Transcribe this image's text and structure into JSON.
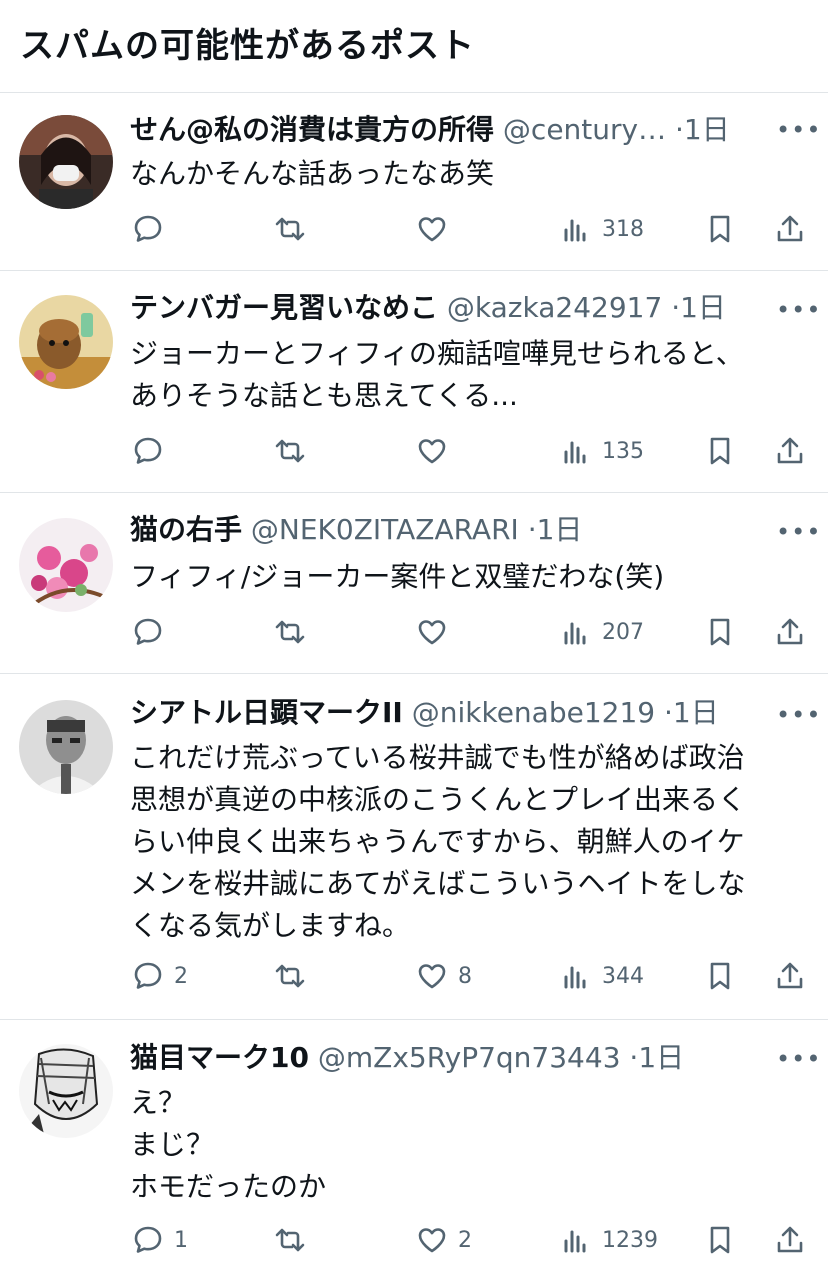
{
  "header": {
    "title": "スパムの可能性があるポスト"
  },
  "posts": [
    {
      "name": "せん@私の消費は貴方の所得",
      "handle": "@century…",
      "time": "·1日",
      "lines": [
        "なんかそんな話あったなあ笑"
      ],
      "reply_count": "",
      "like_count": "",
      "views": "318"
    },
    {
      "name": "テンバガー見習いなめこ",
      "handle": "@kazka242917",
      "time": "·1日",
      "lines": [
        "ジョーカーとフィフィの痴話喧嘩見せられると、",
        "ありそうな話とも思えてくる..."
      ],
      "reply_count": "",
      "like_count": "",
      "views": "135"
    },
    {
      "name": "猫の右手",
      "handle": "@NEK0ZITAZARARI",
      "time": "·1日",
      "lines": [
        "フィフィ/ジョーカー案件と双璧だわな(笑)"
      ],
      "reply_count": "",
      "like_count": "",
      "views": "207"
    },
    {
      "name": "シアトル日顕マークII",
      "handle": "@nikkenabe1219",
      "time": "·1日",
      "lines": [
        "これだけ荒ぶっている桜井誠でも性が絡めば政治",
        "思想が真逆の中核派のこうくんとプレイ出来るく",
        "らい仲良く出来ちゃうんですから、朝鮮人のイケ",
        "メンを桜井誠にあてがえばこういうヘイトをしな",
        "くなる気がしますね。"
      ],
      "reply_count": "2",
      "like_count": "8",
      "views": "344"
    },
    {
      "name": "猫目マーク10",
      "handle": "@mZx5RyP7qn73443",
      "time": "·1日",
      "lines": [
        "え？",
        "まじ？",
        "ホモだったのか"
      ],
      "reply_count": "1",
      "like_count": "2",
      "views": "1239"
    }
  ],
  "icons": {
    "more": "more-dots-icon",
    "reply": "reply-bubble-icon",
    "retweet": "retweet-icon",
    "like": "heart-icon",
    "views": "views-bar-icon",
    "bookmark": "bookmark-icon",
    "share": "share-upload-icon"
  },
  "colors": {
    "text": "#0f1419",
    "secondary": "#536471",
    "divider": "#e1e5e8"
  }
}
